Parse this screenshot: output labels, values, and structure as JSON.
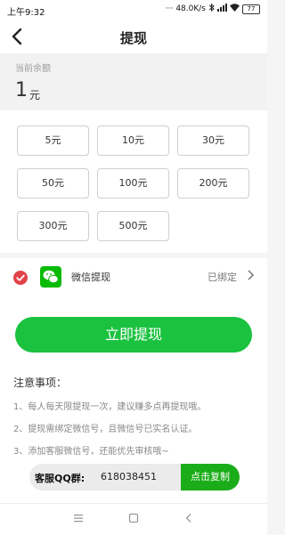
{
  "status_bar": {
    "time": "上午9:32",
    "network_speed": "48.0K/s",
    "battery": "77"
  },
  "nav": {
    "title": "提现",
    "back_icon": "chevron-left-icon"
  },
  "balance": {
    "label": "当前余额",
    "amount": "1",
    "unit": "元"
  },
  "amount_options": [
    "5元",
    "10元",
    "30元",
    "50元",
    "100元",
    "200元",
    "300元",
    "500元"
  ],
  "wechat": {
    "name": "微信提现",
    "status": "已绑定"
  },
  "withdraw_button": "立即提现",
  "notes": {
    "title": "注意事项：",
    "items": [
      "1、每人每天限提现一次，建议赚多点再提现哦。",
      "2、提现需绑定微信号，且微信号已实名认证。",
      "3、添加客服微信号，还能优先审核哦~"
    ]
  },
  "qq_group": {
    "label": "客服QQ群:",
    "number": "618038451",
    "copy_label": "点击复制"
  },
  "colors": {
    "accent_green": "#1bc23f",
    "check_red": "#e2434a",
    "wechat_green": "#09bb07"
  }
}
